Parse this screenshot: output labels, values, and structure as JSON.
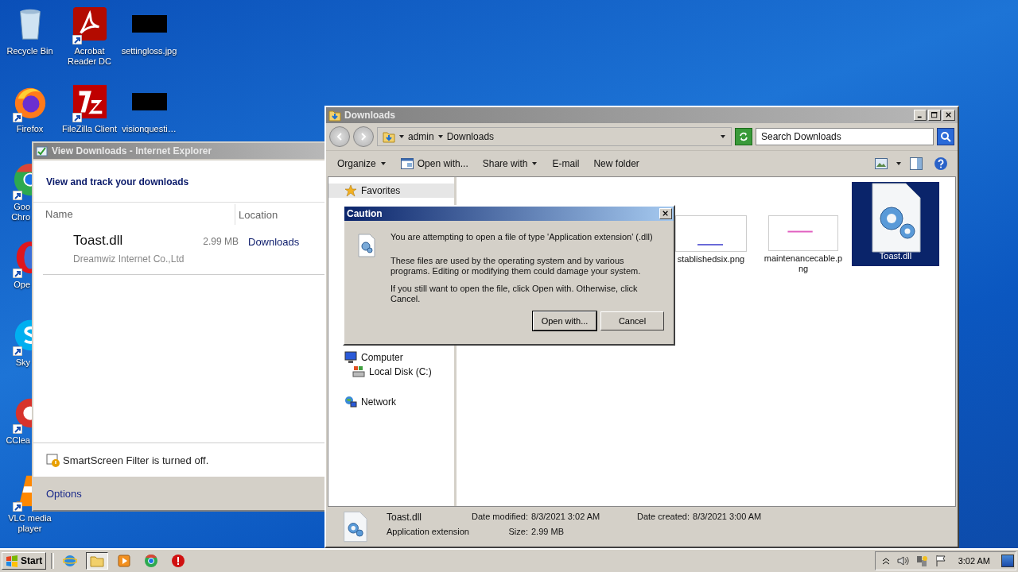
{
  "desktop_columns": [
    [
      {
        "label": "Recycle Bin",
        "kind": "recycle",
        "shortcut": false
      },
      {
        "label": "Firefox",
        "kind": "firefox",
        "shortcut": true
      },
      {
        "label": "Goo\nChro",
        "kind": "chrome",
        "shortcut": true
      },
      {
        "label": "Ope",
        "kind": "opera",
        "shortcut": true
      },
      {
        "label": "Sky",
        "kind": "skype",
        "shortcut": true
      },
      {
        "label": "CClea",
        "kind": "ccleaner",
        "shortcut": true
      },
      {
        "label": "VLC media\nplayer",
        "kind": "vlc",
        "shortcut": true
      }
    ],
    [
      {
        "label": "Acrobat\nReader DC",
        "kind": "acrobat",
        "shortcut": true
      },
      {
        "label": "FileZilla Client",
        "kind": "filezilla",
        "shortcut": true
      }
    ],
    [
      {
        "label": "settingloss.jpg",
        "kind": "redacted",
        "shortcut": false
      },
      {
        "label": "visionquesti…",
        "kind": "redacted",
        "shortcut": false
      }
    ]
  ],
  "ie_window": {
    "title": "View Downloads - Internet Explorer",
    "heading": "View and track your downloads",
    "columns": [
      "Name",
      "Location"
    ],
    "downloads": [
      {
        "name": "Toast.dll",
        "publisher": "Dreamwiz Internet Co.,Ltd",
        "size": "2.99 MB",
        "location": "Downloads"
      }
    ],
    "smartscreen": "SmartScreen Filter is turned off.",
    "options": "Options"
  },
  "explorer": {
    "title": "Downloads",
    "breadcrumb": [
      "admin",
      "Downloads"
    ],
    "search": {
      "placeholder": "Search Downloads"
    },
    "commands": [
      {
        "label": "Organize",
        "kind": "menu"
      },
      {
        "label": "Open with...",
        "kind": "icon"
      },
      {
        "label": "Share with",
        "kind": "menu"
      },
      {
        "label": "E-mail",
        "kind": "plain"
      },
      {
        "label": "New folder",
        "kind": "plain"
      }
    ],
    "nav": [
      {
        "label": "Favorites",
        "kind": "favorites",
        "selected": true
      },
      {
        "label": "Computer",
        "kind": "computer",
        "selected": false,
        "children": [
          {
            "label": "Local Disk (C:)",
            "kind": "disk",
            "selected": false
          }
        ]
      },
      {
        "label": "Network",
        "kind": "network",
        "selected": false
      }
    ],
    "files": [
      {
        "name": "stablishedsix.png",
        "kind": "image",
        "selected": false,
        "color": "#6a6ad8"
      },
      {
        "name": "maintenancecable.png",
        "kind": "image",
        "selected": false,
        "color": "#e060c0"
      },
      {
        "name": "Toast.dll",
        "kind": "dll",
        "selected": true
      }
    ],
    "details": {
      "name": "Toast.dll",
      "type": "Application extension",
      "fields": [
        {
          "label": "Date modified:",
          "value": "8/3/2021 3:02 AM"
        },
        {
          "label": "Size:",
          "value": "2.99 MB"
        },
        {
          "label": "Date created:",
          "value": "8/3/2021 3:00 AM"
        }
      ]
    }
  },
  "dialog": {
    "title": "Caution",
    "paragraphs": [
      "You are attempting to open a file of type 'Application extension' (.dll)",
      "These files are used by the operating system and by various programs. Editing or modifying them could damage your system.",
      "If you still want to open the file, click Open with. Otherwise, click Cancel."
    ],
    "buttons": [
      {
        "label": "Open with...",
        "default": true
      },
      {
        "label": "Cancel",
        "default": false
      }
    ]
  },
  "taskbar": {
    "start": "Start",
    "apps": [
      {
        "kind": "ie",
        "active": false
      },
      {
        "kind": "explorer",
        "active": true
      },
      {
        "kind": "media",
        "active": false
      },
      {
        "kind": "chrome",
        "active": false
      },
      {
        "kind": "alert",
        "active": false
      }
    ],
    "clock": "3:02 AM"
  }
}
